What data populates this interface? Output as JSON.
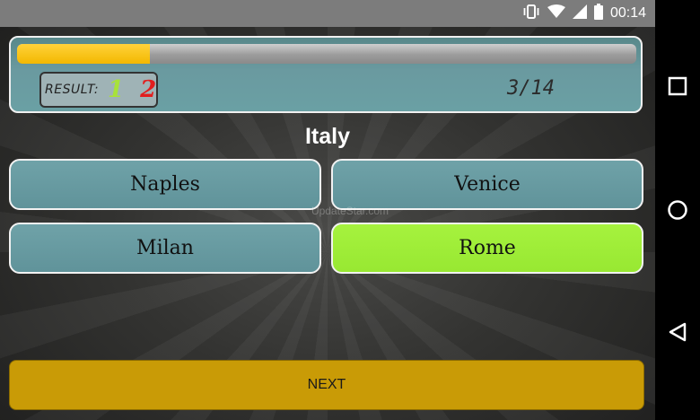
{
  "status_bar": {
    "time": "00:14",
    "icons": [
      "vibrate-icon",
      "wifi-icon",
      "signal-icon",
      "battery-icon"
    ]
  },
  "quiz": {
    "progress_fraction": 0.214,
    "result_label": "RESULT:",
    "score_correct": "1",
    "score_wrong": "2",
    "question_count": "3/14",
    "question": "Italy",
    "answers": [
      {
        "label": "Naples",
        "state": "normal"
      },
      {
        "label": "Venice",
        "state": "normal"
      },
      {
        "label": "Milan",
        "state": "normal"
      },
      {
        "label": "Rome",
        "state": "correct"
      }
    ],
    "watermark": "UpdateStar.com",
    "next_label": "NEXT"
  },
  "colors": {
    "progress": "#f3b800",
    "correct_answer": "#9cec36",
    "answer": "#66989e",
    "next_button": "#c99b06",
    "score_correct": "#a8e23a",
    "score_wrong": "#e21e1e"
  },
  "nav_bar": {
    "icons": [
      "recent-apps-icon",
      "home-icon",
      "back-icon"
    ]
  }
}
